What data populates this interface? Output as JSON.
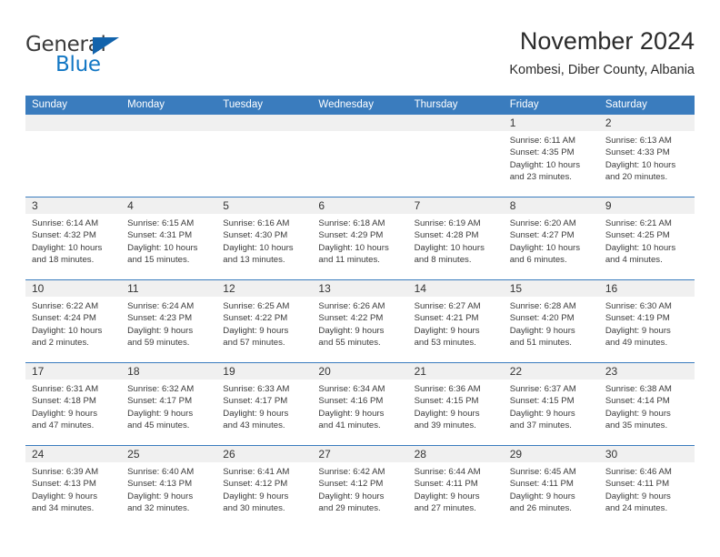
{
  "brand": {
    "name_part1": "General",
    "name_part2": "Blue",
    "triangle_color": "#1263ac",
    "blue_color": "#1277c4"
  },
  "header": {
    "title": "November 2024",
    "subtitle": "Kombesi, Diber County, Albania"
  },
  "theme": {
    "header_blue": "#3a7cbe",
    "daynum_bg": "#f0f0f0",
    "text": "#333333"
  },
  "weekdays": [
    "Sunday",
    "Monday",
    "Tuesday",
    "Wednesday",
    "Thursday",
    "Friday",
    "Saturday"
  ],
  "labels": {
    "sunrise_prefix": "Sunrise:",
    "sunset_prefix": "Sunset:",
    "daylight_prefix": "Daylight:"
  },
  "weeks": [
    [
      {
        "empty": true
      },
      {
        "empty": true
      },
      {
        "empty": true
      },
      {
        "empty": true
      },
      {
        "empty": true
      },
      {
        "day": "1",
        "sunrise": "Sunrise: 6:11 AM",
        "sunset": "Sunset: 4:35 PM",
        "daylight_1": "Daylight: 10 hours",
        "daylight_2": "and 23 minutes."
      },
      {
        "day": "2",
        "sunrise": "Sunrise: 6:13 AM",
        "sunset": "Sunset: 4:33 PM",
        "daylight_1": "Daylight: 10 hours",
        "daylight_2": "and 20 minutes."
      }
    ],
    [
      {
        "day": "3",
        "sunrise": "Sunrise: 6:14 AM",
        "sunset": "Sunset: 4:32 PM",
        "daylight_1": "Daylight: 10 hours",
        "daylight_2": "and 18 minutes."
      },
      {
        "day": "4",
        "sunrise": "Sunrise: 6:15 AM",
        "sunset": "Sunset: 4:31 PM",
        "daylight_1": "Daylight: 10 hours",
        "daylight_2": "and 15 minutes."
      },
      {
        "day": "5",
        "sunrise": "Sunrise: 6:16 AM",
        "sunset": "Sunset: 4:30 PM",
        "daylight_1": "Daylight: 10 hours",
        "daylight_2": "and 13 minutes."
      },
      {
        "day": "6",
        "sunrise": "Sunrise: 6:18 AM",
        "sunset": "Sunset: 4:29 PM",
        "daylight_1": "Daylight: 10 hours",
        "daylight_2": "and 11 minutes."
      },
      {
        "day": "7",
        "sunrise": "Sunrise: 6:19 AM",
        "sunset": "Sunset: 4:28 PM",
        "daylight_1": "Daylight: 10 hours",
        "daylight_2": "and 8 minutes."
      },
      {
        "day": "8",
        "sunrise": "Sunrise: 6:20 AM",
        "sunset": "Sunset: 4:27 PM",
        "daylight_1": "Daylight: 10 hours",
        "daylight_2": "and 6 minutes."
      },
      {
        "day": "9",
        "sunrise": "Sunrise: 6:21 AM",
        "sunset": "Sunset: 4:25 PM",
        "daylight_1": "Daylight: 10 hours",
        "daylight_2": "and 4 minutes."
      }
    ],
    [
      {
        "day": "10",
        "sunrise": "Sunrise: 6:22 AM",
        "sunset": "Sunset: 4:24 PM",
        "daylight_1": "Daylight: 10 hours",
        "daylight_2": "and 2 minutes."
      },
      {
        "day": "11",
        "sunrise": "Sunrise: 6:24 AM",
        "sunset": "Sunset: 4:23 PM",
        "daylight_1": "Daylight: 9 hours",
        "daylight_2": "and 59 minutes."
      },
      {
        "day": "12",
        "sunrise": "Sunrise: 6:25 AM",
        "sunset": "Sunset: 4:22 PM",
        "daylight_1": "Daylight: 9 hours",
        "daylight_2": "and 57 minutes."
      },
      {
        "day": "13",
        "sunrise": "Sunrise: 6:26 AM",
        "sunset": "Sunset: 4:22 PM",
        "daylight_1": "Daylight: 9 hours",
        "daylight_2": "and 55 minutes."
      },
      {
        "day": "14",
        "sunrise": "Sunrise: 6:27 AM",
        "sunset": "Sunset: 4:21 PM",
        "daylight_1": "Daylight: 9 hours",
        "daylight_2": "and 53 minutes."
      },
      {
        "day": "15",
        "sunrise": "Sunrise: 6:28 AM",
        "sunset": "Sunset: 4:20 PM",
        "daylight_1": "Daylight: 9 hours",
        "daylight_2": "and 51 minutes."
      },
      {
        "day": "16",
        "sunrise": "Sunrise: 6:30 AM",
        "sunset": "Sunset: 4:19 PM",
        "daylight_1": "Daylight: 9 hours",
        "daylight_2": "and 49 minutes."
      }
    ],
    [
      {
        "day": "17",
        "sunrise": "Sunrise: 6:31 AM",
        "sunset": "Sunset: 4:18 PM",
        "daylight_1": "Daylight: 9 hours",
        "daylight_2": "and 47 minutes."
      },
      {
        "day": "18",
        "sunrise": "Sunrise: 6:32 AM",
        "sunset": "Sunset: 4:17 PM",
        "daylight_1": "Daylight: 9 hours",
        "daylight_2": "and 45 minutes."
      },
      {
        "day": "19",
        "sunrise": "Sunrise: 6:33 AM",
        "sunset": "Sunset: 4:17 PM",
        "daylight_1": "Daylight: 9 hours",
        "daylight_2": "and 43 minutes."
      },
      {
        "day": "20",
        "sunrise": "Sunrise: 6:34 AM",
        "sunset": "Sunset: 4:16 PM",
        "daylight_1": "Daylight: 9 hours",
        "daylight_2": "and 41 minutes."
      },
      {
        "day": "21",
        "sunrise": "Sunrise: 6:36 AM",
        "sunset": "Sunset: 4:15 PM",
        "daylight_1": "Daylight: 9 hours",
        "daylight_2": "and 39 minutes."
      },
      {
        "day": "22",
        "sunrise": "Sunrise: 6:37 AM",
        "sunset": "Sunset: 4:15 PM",
        "daylight_1": "Daylight: 9 hours",
        "daylight_2": "and 37 minutes."
      },
      {
        "day": "23",
        "sunrise": "Sunrise: 6:38 AM",
        "sunset": "Sunset: 4:14 PM",
        "daylight_1": "Daylight: 9 hours",
        "daylight_2": "and 35 minutes."
      }
    ],
    [
      {
        "day": "24",
        "sunrise": "Sunrise: 6:39 AM",
        "sunset": "Sunset: 4:13 PM",
        "daylight_1": "Daylight: 9 hours",
        "daylight_2": "and 34 minutes."
      },
      {
        "day": "25",
        "sunrise": "Sunrise: 6:40 AM",
        "sunset": "Sunset: 4:13 PM",
        "daylight_1": "Daylight: 9 hours",
        "daylight_2": "and 32 minutes."
      },
      {
        "day": "26",
        "sunrise": "Sunrise: 6:41 AM",
        "sunset": "Sunset: 4:12 PM",
        "daylight_1": "Daylight: 9 hours",
        "daylight_2": "and 30 minutes."
      },
      {
        "day": "27",
        "sunrise": "Sunrise: 6:42 AM",
        "sunset": "Sunset: 4:12 PM",
        "daylight_1": "Daylight: 9 hours",
        "daylight_2": "and 29 minutes."
      },
      {
        "day": "28",
        "sunrise": "Sunrise: 6:44 AM",
        "sunset": "Sunset: 4:11 PM",
        "daylight_1": "Daylight: 9 hours",
        "daylight_2": "and 27 minutes."
      },
      {
        "day": "29",
        "sunrise": "Sunrise: 6:45 AM",
        "sunset": "Sunset: 4:11 PM",
        "daylight_1": "Daylight: 9 hours",
        "daylight_2": "and 26 minutes."
      },
      {
        "day": "30",
        "sunrise": "Sunrise: 6:46 AM",
        "sunset": "Sunset: 4:11 PM",
        "daylight_1": "Daylight: 9 hours",
        "daylight_2": "and 24 minutes."
      }
    ]
  ]
}
